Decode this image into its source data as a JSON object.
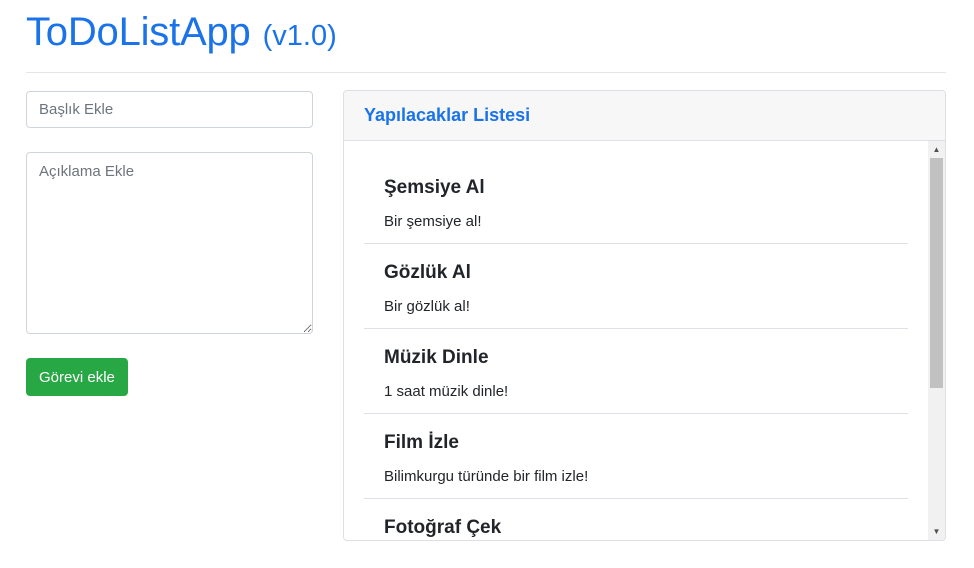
{
  "header": {
    "title": "ToDoListApp",
    "version": "(v1.0)"
  },
  "form": {
    "title_placeholder": "Başlık Ekle",
    "description_placeholder": "Açıklama Ekle",
    "submit_label": "Görevi ekle"
  },
  "list": {
    "heading": "Yapılacaklar Listesi",
    "items": [
      {
        "title": "Şemsiye Al",
        "description": "Bir şemsiye al!"
      },
      {
        "title": "Gözlük Al",
        "description": "Bir gözlük al!"
      },
      {
        "title": "Müzik Dinle",
        "description": "1 saat müzik dinle!"
      },
      {
        "title": "Film İzle",
        "description": "Bilimkurgu türünde bir film izle!"
      },
      {
        "title": "Fotoğraf Çek",
        "description": ""
      }
    ]
  },
  "icons": {
    "scroll_up": "triangle-up-icon",
    "scroll_down": "triangle-down-icon"
  },
  "colors": {
    "brand": "#1a73e8",
    "submit_button": "#28a745"
  }
}
